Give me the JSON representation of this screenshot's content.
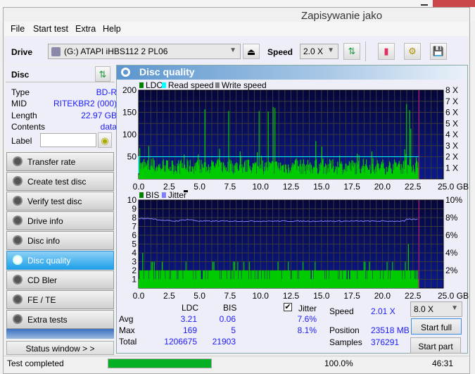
{
  "background_window": {
    "title": "Zapisywanie jako"
  },
  "menu": [
    "File",
    "Start test",
    "Extra",
    "Help"
  ],
  "toolbar": {
    "drive_label": "Drive",
    "drive_value": "(G:)   ATAPI iHBS112   2 PL06",
    "speed_label": "Speed",
    "speed_value": "2.0 X"
  },
  "disc": {
    "header": "Disc",
    "rows": [
      {
        "k": "Type",
        "v": "BD-R"
      },
      {
        "k": "MID",
        "v": "RITEKBR2 (000)"
      },
      {
        "k": "Length",
        "v": "22.97 GB"
      },
      {
        "k": "Contents",
        "v": "data"
      }
    ],
    "label_label": "Label",
    "label_value": ""
  },
  "nav": [
    {
      "label": "Transfer rate"
    },
    {
      "label": "Create test disc"
    },
    {
      "label": "Verify test disc"
    },
    {
      "label": "Drive info"
    },
    {
      "label": "Disc info"
    },
    {
      "label": "Disc quality",
      "active": true
    },
    {
      "label": "CD Bler"
    },
    {
      "label": "FE / TE"
    },
    {
      "label": "Extra tests"
    }
  ],
  "status_window_button": "Status window > >",
  "panel": {
    "title": "Disc quality"
  },
  "colors": {
    "ldc": "#008000",
    "read_speed": "#00ffff",
    "write_speed": "#808080",
    "bis": "#008000",
    "jitter": "#8080ff",
    "bars": "#00cc00",
    "progress": "#06b025"
  },
  "chart_data": [
    {
      "type": "bar",
      "legend": [
        "LDC",
        "Read speed",
        "Write speed"
      ],
      "x_ticks": [
        "0.0",
        "2.5",
        "5.0",
        "7.5",
        "10.0",
        "12.5",
        "15.0",
        "17.5",
        "20.0",
        "22.5",
        "25.0 GB"
      ],
      "y_ticks": [
        "50",
        "100",
        "150",
        "200"
      ],
      "y2_ticks": [
        "1 X",
        "2 X",
        "3 X",
        "4 X",
        "5 X",
        "6 X",
        "7 X",
        "8 X"
      ],
      "xlim": [
        0,
        25
      ],
      "ylim": [
        0,
        200
      ],
      "y2lim": [
        0,
        8
      ],
      "grid": true,
      "data_end_gb": 23.0,
      "ldc_typical_range": [
        10,
        45
      ],
      "ldc_peaks": [
        [
          0.05,
          70
        ],
        [
          0.8,
          74
        ],
        [
          3.7,
          55
        ],
        [
          5.4,
          157
        ],
        [
          6.6,
          68
        ],
        [
          7.35,
          153
        ],
        [
          8.3,
          62
        ],
        [
          9.7,
          60
        ],
        [
          9.85,
          153
        ],
        [
          10.6,
          152
        ],
        [
          11.0,
          162
        ],
        [
          11.15,
          160
        ],
        [
          14.5,
          85
        ],
        [
          15.0,
          73
        ],
        [
          19.1,
          62
        ],
        [
          21.8,
          67
        ],
        [
          21.95,
          169
        ],
        [
          22.2,
          155
        ],
        [
          22.3,
          113
        ]
      ],
      "read_speed_x": 2.0
    },
    {
      "type": "bar",
      "legend": [
        "BIS",
        "Jitter"
      ],
      "x_ticks": [
        "0.0",
        "2.5",
        "5.0",
        "7.5",
        "10.0",
        "12.5",
        "15.0",
        "17.5",
        "20.0",
        "22.5",
        "25.0 GB"
      ],
      "y_ticks": [
        "1",
        "2",
        "3",
        "4",
        "5",
        "6",
        "7",
        "8",
        "9",
        "10"
      ],
      "y2_ticks": [
        "2%",
        "4%",
        "6%",
        "8%",
        "10%"
      ],
      "xlim": [
        0,
        25
      ],
      "ylim": [
        0,
        10
      ],
      "y2lim": [
        0,
        10
      ],
      "grid": true,
      "data_end_gb": 23.0,
      "bis_peaks": [
        [
          0.3,
          4
        ],
        [
          22.1,
          5
        ]
      ],
      "bis_typical": 2,
      "jitter_pct": [
        [
          0,
          7.9
        ],
        [
          1,
          7.9
        ],
        [
          2,
          7.7
        ],
        [
          3,
          7.6
        ],
        [
          4,
          7.8
        ],
        [
          5,
          7.6
        ],
        [
          7.5,
          7.6
        ],
        [
          10,
          7.6
        ],
        [
          15,
          7.6
        ],
        [
          20,
          7.6
        ],
        [
          21.8,
          7.6
        ],
        [
          22,
          7.8
        ],
        [
          23,
          7.8
        ]
      ]
    }
  ],
  "stats": {
    "col_ldc": "LDC",
    "col_bis": "BIS",
    "jitter_label": "Jitter",
    "jitter_checked": true,
    "rows": [
      {
        "k": "Avg",
        "ldc": "3.21",
        "bis": "0.06",
        "jit": "7.6%"
      },
      {
        "k": "Max",
        "ldc": "169",
        "bis": "5",
        "jit": "8.1%"
      },
      {
        "k": "Total",
        "ldc": "1206675",
        "bis": "21903",
        "jit": ""
      }
    ],
    "speed_label": "Speed",
    "speed_value": "2.01 X",
    "position_label": "Position",
    "position_value": "23518 MB",
    "samples_label": "Samples",
    "samples_value": "376291",
    "speed_select": "8.0 X",
    "start_full": "Start full",
    "start_part": "Start part"
  },
  "statusbar": {
    "text": "Test completed",
    "progress": 100,
    "progress_text": "100.0%",
    "time": "46:31"
  }
}
